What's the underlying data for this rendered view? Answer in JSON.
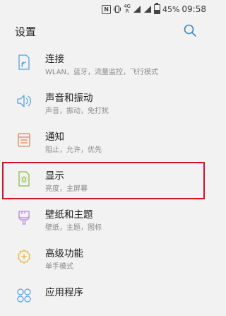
{
  "status_bar": {
    "network_type": "4G",
    "signal_label": "R",
    "battery_percent": "45%",
    "battery_level": 0.45,
    "time": "09:58"
  },
  "header": {
    "title": "设置"
  },
  "items": [
    {
      "title": "连接",
      "subtitle": "WLAN，蓝牙，流量监控，飞行模式",
      "icon": "connections-icon",
      "icon_color": "#5aa3dc"
    },
    {
      "title": "声音和振动",
      "subtitle": "声音，振动，免打扰",
      "icon": "speaker-icon",
      "icon_color": "#5aa3dc"
    },
    {
      "title": "通知",
      "subtitle": "阻止，允许，优先",
      "icon": "notifications-icon",
      "icon_color": "#e08562"
    },
    {
      "title": "显示",
      "subtitle": "亮度，主屏幕",
      "icon": "display-icon",
      "icon_color": "#8fbd4a"
    },
    {
      "title": "壁纸和主题",
      "subtitle": "壁纸，主题，图标",
      "icon": "paintbrush-icon",
      "icon_color": "#b68bd6"
    },
    {
      "title": "高级功能",
      "subtitle": "单手模式",
      "icon": "gear-plus-icon",
      "icon_color": "#e7b53d"
    },
    {
      "title": "应用程序",
      "subtitle": "",
      "icon": "apps-icon",
      "icon_color": "#5aa3dc"
    }
  ],
  "colors": {
    "background": "#f2f2f2",
    "highlight_border": "#c8172c",
    "search_icon": "#3a88c5"
  }
}
